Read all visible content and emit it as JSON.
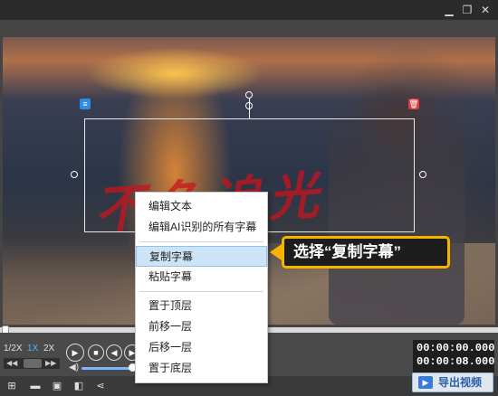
{
  "window": {
    "restore_icon": "restore-icon",
    "close_icon": "close-icon"
  },
  "video": {
    "watermark_text": "不负追光"
  },
  "selection": {
    "menu_badge": "≡",
    "delete_badge": "🗑"
  },
  "speed": {
    "options": [
      "1/2X",
      "1X",
      "2X"
    ],
    "active": "1X"
  },
  "timecodes": {
    "current": "00:00:00.000",
    "total": "00:00:08.000"
  },
  "context_menu": {
    "items": [
      {
        "label": "编辑文本"
      },
      {
        "label": "编辑AI识别的所有字幕"
      },
      {
        "label": "复制字幕",
        "highlighted": true
      },
      {
        "label": "粘贴字幕"
      },
      {
        "label": "置于顶层"
      },
      {
        "label": "前移一层"
      },
      {
        "label": "后移一层"
      },
      {
        "label": "置于底层"
      }
    ]
  },
  "callout": {
    "text": "选择“复制字幕”"
  },
  "export": {
    "label": "导出视频"
  },
  "colors": {
    "accent": "#f6b400",
    "highlight": "#cde4f7",
    "speed_active": "#4fb6ff"
  }
}
